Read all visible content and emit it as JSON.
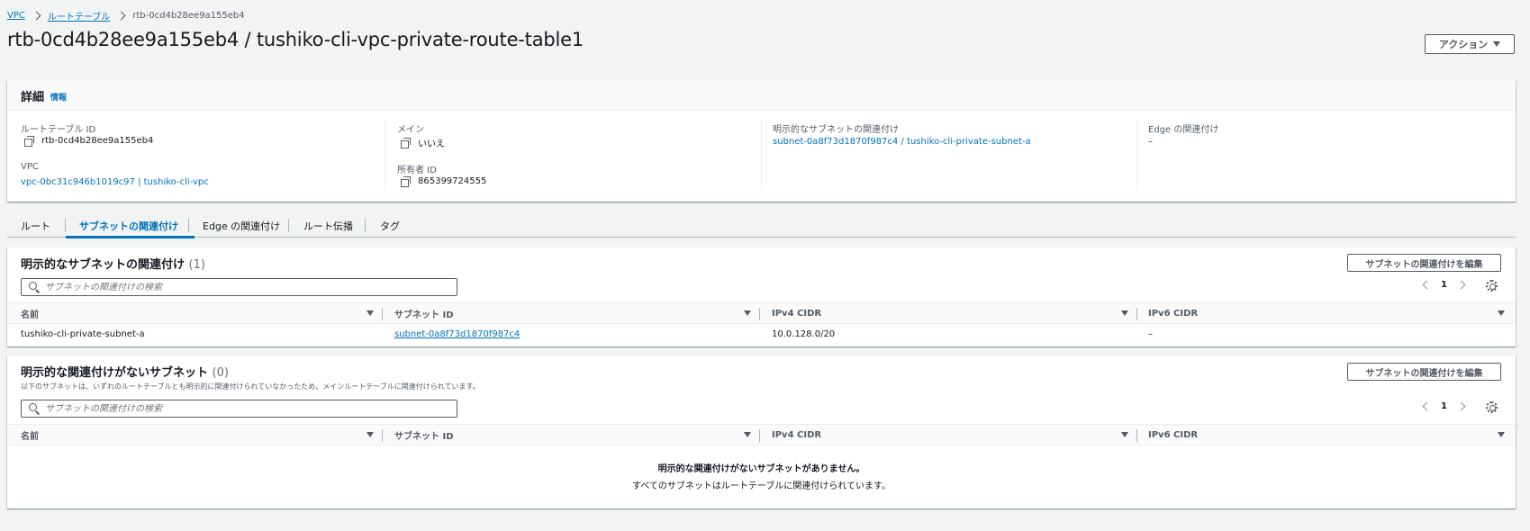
{
  "breadcrumb": {
    "items": [
      "VPC",
      "ルートテーブル"
    ],
    "current": "rtb-0cd4b28ee9a155eb4"
  },
  "page": {
    "title": "rtb-0cd4b28ee9a155eb4 / tushiko-cli-vpc-private-route-table1",
    "actions_label": "アクション"
  },
  "details": {
    "title": "詳細",
    "info_label": "情報",
    "route_table_id_label": "ルートテーブル ID",
    "route_table_id": "rtb-0cd4b28ee9a155eb4",
    "vpc_label": "VPC",
    "vpc_value": "vpc-0bc31c946b1019c97 | tushiko-cli-vpc",
    "main_label": "メイン",
    "main_value": "いいえ",
    "owner_label": "所有者 ID",
    "owner_value": "865399724555",
    "explicit_assoc_label": "明示的なサブネットの関連付け",
    "explicit_assoc_value": "subnet-0a8f73d1870f987c4 / tushiko-cli-private-subnet-a",
    "edge_assoc_label": "Edge の関連付け",
    "edge_assoc_value": "–"
  },
  "tabs": [
    {
      "label": "ルート"
    },
    {
      "label": "サブネットの関連付け"
    },
    {
      "label": "Edge の関連付け"
    },
    {
      "label": "ルート伝播"
    },
    {
      "label": "タグ"
    }
  ],
  "explicit_section": {
    "title": "明示的なサブネットの関連付け",
    "count": "(1)",
    "edit_label": "サブネットの関連付けを編集",
    "search_placeholder": "サブネットの関連付けの検索",
    "page_number": "1",
    "columns": [
      "名前",
      "サブネット ID",
      "IPv4 CIDR",
      "IPv6 CIDR"
    ],
    "rows": [
      {
        "name": "tushiko-cli-private-subnet-a",
        "subnet_id": "subnet-0a8f73d1870f987c4",
        "ipv4": "10.0.128.0/20",
        "ipv6": "–"
      }
    ]
  },
  "implicit_section": {
    "title": "明示的な関連付けがないサブネット",
    "count": "(0)",
    "description": "以下のサブネットは、いずれのルートテーブルとも明示的に関連付けられていなかったため、メインルートテーブルに関連付けられています。",
    "edit_label": "サブネットの関連付けを編集",
    "search_placeholder": "サブネットの関連付けの検索",
    "page_number": "1",
    "columns": [
      "名前",
      "サブネット ID",
      "IPv4 CIDR",
      "IPv6 CIDR"
    ],
    "empty_title": "明示的な関連付けがないサブネットがありません。",
    "empty_message": "すべてのサブネットはルートテーブルに関連付けられています。"
  },
  "colors": {
    "link": "#0073bb",
    "background": "#f2f3f3",
    "text": "#16191f"
  }
}
